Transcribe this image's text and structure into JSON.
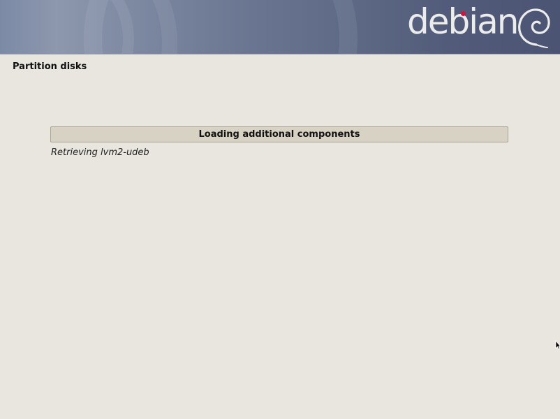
{
  "header": {
    "logo_text": "debian",
    "logo_dot_color": "#c8183d",
    "logo_icon": "debian-swirl-icon"
  },
  "page": {
    "title": "Partition disks"
  },
  "progress": {
    "label": "Loading additional components",
    "fraction": 0,
    "status": "Retrieving lvm2-udeb"
  },
  "colors": {
    "background": "#e8e6df",
    "progress_track": "#d8d2c4",
    "banner_dark": "#4b5473",
    "banner_light": "#8d97ad"
  },
  "cursor": {
    "icon": "mouse-pointer-icon"
  }
}
